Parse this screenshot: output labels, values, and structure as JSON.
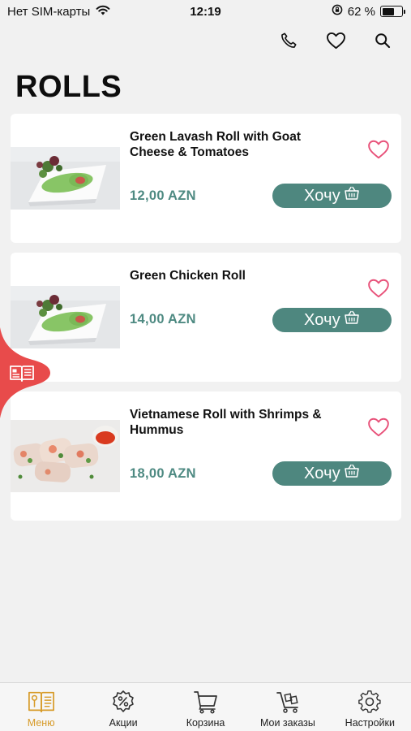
{
  "status_bar": {
    "carrier": "Нет SIM-карты",
    "time": "12:19",
    "battery_text": "62 %",
    "battery_level": 0.62
  },
  "top_actions": {
    "icons": [
      "phone-icon",
      "heart-icon",
      "search-icon"
    ]
  },
  "page": {
    "title": "ROLLS"
  },
  "products": [
    {
      "name": "Green Lavash Roll with Goat Cheese & Tomatoes",
      "price": "12,00 AZN",
      "button": "Хочу"
    },
    {
      "name": "Green Chicken Roll",
      "price": "14,00 AZN",
      "button": "Хочу"
    },
    {
      "name": "Vietnamese Roll with Shrimps & Hummus",
      "price": "18,00 AZN",
      "button": "Хочу"
    }
  ],
  "tab_bar": {
    "tabs": [
      {
        "label": "Меню",
        "icon": "menu-book-icon",
        "active": true
      },
      {
        "label": "Акции",
        "icon": "discount-icon",
        "active": false
      },
      {
        "label": "Корзина",
        "icon": "cart-icon",
        "active": false
      },
      {
        "label": "Мои заказы",
        "icon": "orders-cart-icon",
        "active": false
      },
      {
        "label": "Настройки",
        "icon": "gear-icon",
        "active": false
      }
    ]
  },
  "colors": {
    "accent_green": "#4e877f",
    "price_green": "#4e8a82",
    "heart_pink": "#e8527a",
    "tab_active": "#d79a27",
    "float_tab_red": "#e84b4b"
  }
}
